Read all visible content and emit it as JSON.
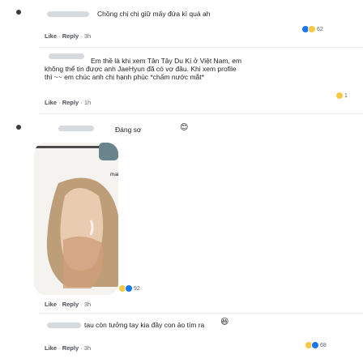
{
  "comments": [
    {
      "text": "Chồng chị chị giữ mấy đứa kì quá ah",
      "actions": {
        "like": "Like",
        "reply": "Reply",
        "time": "3h"
      },
      "reactions": {
        "count": "62"
      }
    },
    {
      "lines": [
        "Em thề là khi xem Tân Tây Du Kí ở Việt Nam, em",
        "không thể tin được anh JaeHyun đã có vợ đâu. Khi xem profile",
        "thì ~~ em chúc anh chị hạnh phúc *chấm nước mắt*"
      ],
      "actions": {
        "like": "Like",
        "reply": "Reply",
        "time": "1h"
      },
      "reactions": {
        "count": "1"
      }
    },
    {
      "text": "Đáng sợ",
      "image_caption": "mai",
      "actions": {
        "like": "Like",
        "reply": "Reply",
        "time": "3h"
      },
      "reactions": {
        "count": "92"
      }
    },
    {
      "text": "tau còn tưởng tay kia đầy con ảo tím ra",
      "actions": {
        "like": "Like",
        "reply": "Reply",
        "time": "3h"
      },
      "reactions": {
        "count": "68"
      }
    }
  ],
  "separator": "·",
  "colors": {
    "bubble": "#f2f3f5",
    "meta": "#606770",
    "like": "#1877f2",
    "haha": "#f7c844"
  }
}
